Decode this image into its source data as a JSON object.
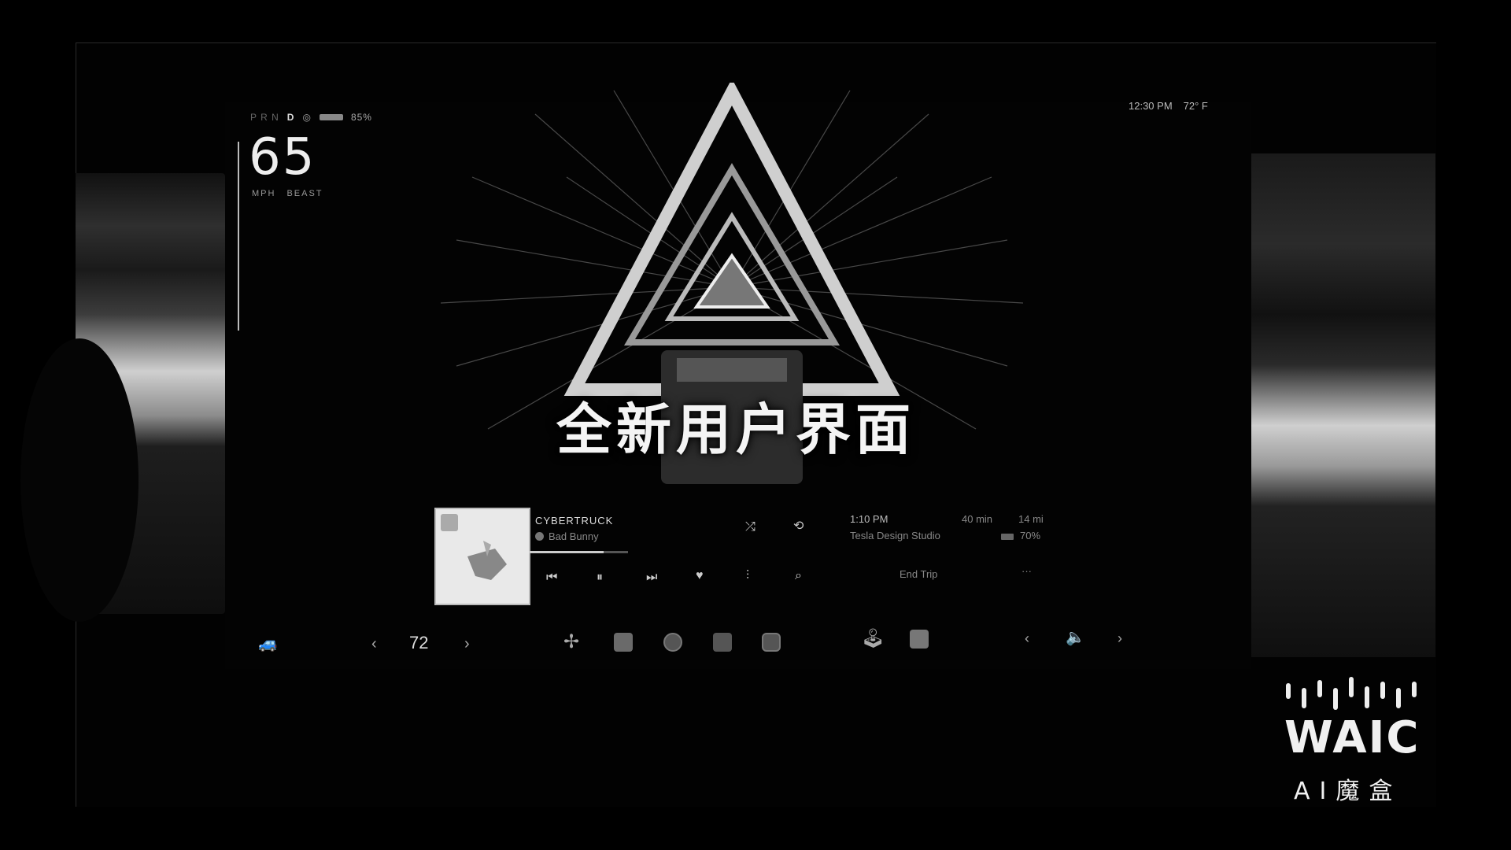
{
  "status": {
    "prnd": "P R N",
    "gear": "D",
    "battery_percent": "85%",
    "time": "12:30 PM",
    "outside_temp": "72° F"
  },
  "speed": {
    "value": "65",
    "unit": "MPH",
    "mode": "BEAST"
  },
  "headline": "全新用户界面",
  "media": {
    "title": "CYBERTRUCK",
    "artist": "Bad Bunny",
    "progress_fraction": 0.75
  },
  "trip": {
    "arrival_time": "1:10 PM",
    "duration": "40 min",
    "distance": "14 mi",
    "destination": "Tesla Design Studio",
    "arrival_battery": "70%",
    "end_trip_label": "End Trip",
    "more_label": "···"
  },
  "dock": {
    "cabin_temp": "72",
    "left_arrow": "‹",
    "right_arrow": "›"
  },
  "logo": {
    "name": "WAIC",
    "sub": "AI魔盒"
  },
  "colors": {
    "background": "#000000",
    "text": "#dddddd",
    "accent": "#f4f4f4"
  }
}
